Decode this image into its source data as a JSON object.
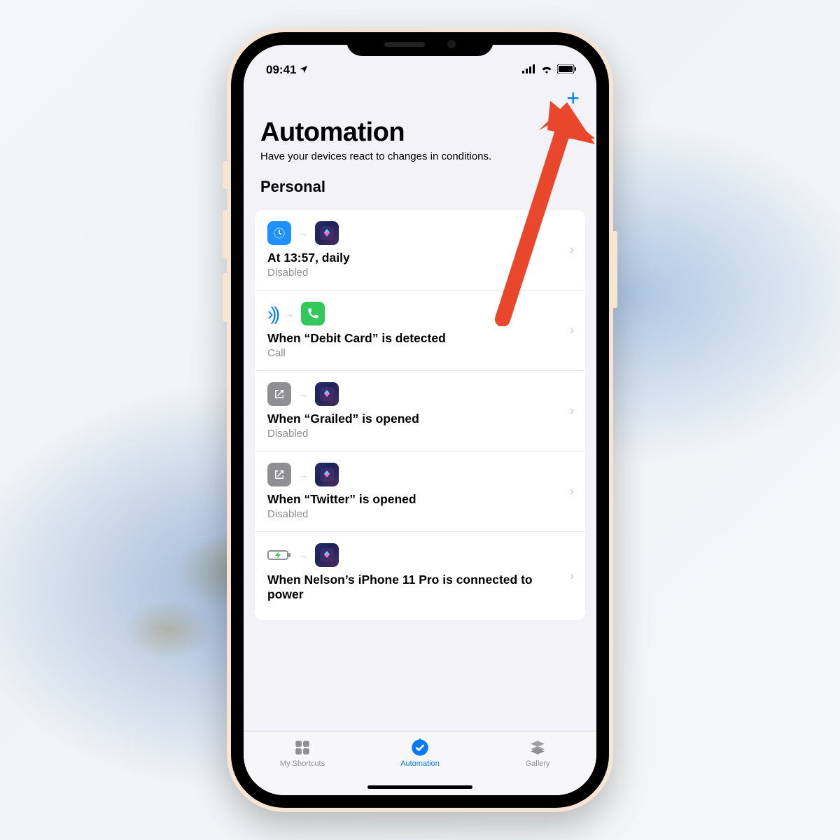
{
  "status": {
    "time": "09:41",
    "location_glyph": "➤"
  },
  "navbar": {
    "add": "+"
  },
  "header": {
    "title": "Automation",
    "subtitle": "Have your devices react to changes in conditions.",
    "section": "Personal"
  },
  "automations": [
    {
      "trigger_icon": "clock",
      "action_icon": "shortcut",
      "title": "At 13:57, daily",
      "subtitle": "Disabled"
    },
    {
      "trigger_icon": "nfc",
      "action_icon": "phone",
      "title": "When “Debit Card” is detected",
      "subtitle": "Call"
    },
    {
      "trigger_icon": "openapp",
      "action_icon": "shortcut",
      "title": "When “Grailed” is opened",
      "subtitle": "Disabled"
    },
    {
      "trigger_icon": "openapp",
      "action_icon": "shortcut",
      "title": "When “Twitter” is opened",
      "subtitle": "Disabled"
    },
    {
      "trigger_icon": "battery",
      "action_icon": "shortcut",
      "title": "When Nelson’s iPhone 11 Pro is connected to power",
      "subtitle": ""
    }
  ],
  "tabs": {
    "shortcuts": "My Shortcuts",
    "automation": "Automation",
    "gallery": "Gallery"
  },
  "colors": {
    "accent": "#007aff",
    "annotation": "#e8472b"
  }
}
